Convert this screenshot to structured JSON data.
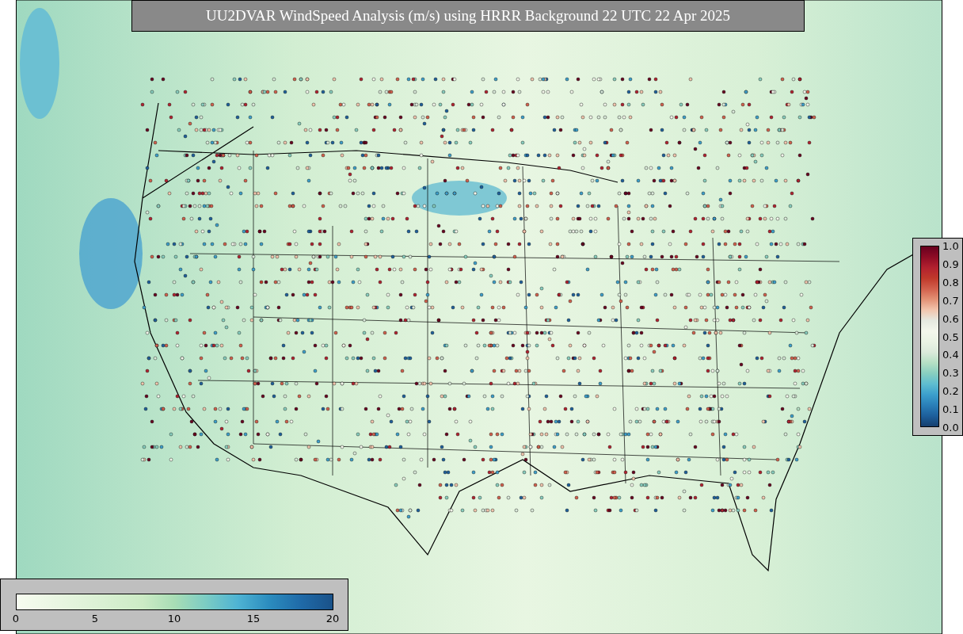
{
  "title": "UU2DVAR WindSpeed Analysis (m/s) using HRRR Background 22 UTC 22 Apr 2025",
  "station_colorbar": {
    "ticks": [
      "1.0",
      "0.9",
      "0.8",
      "0.7",
      "0.6",
      "0.5",
      "0.4",
      "0.3",
      "0.2",
      "0.1",
      "0.0"
    ]
  },
  "windspeed_colorbar": {
    "ticks": [
      "0",
      "5",
      "10",
      "15",
      "20"
    ]
  }
}
